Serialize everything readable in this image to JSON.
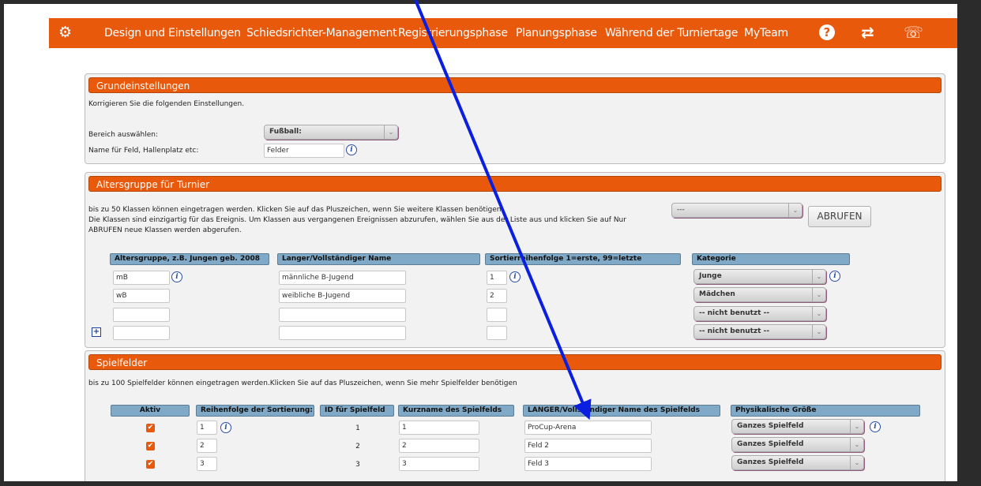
{
  "nav": {
    "items": [
      "Design und Einstellungen",
      "Schiedsrichter-Management",
      "Registrierungsphase",
      "Planungsphase",
      "Während der Turniertage",
      "MyTeam"
    ],
    "icons": [
      "gear-icon",
      "help-icon",
      "refresh-icon",
      "chat-icon"
    ]
  },
  "grund": {
    "title": "Grundeinstellungen",
    "desc": "Korrigieren Sie die folgenden Einstellungen.",
    "bereich_label": "Bereich auswählen:",
    "bereich_value": "Fußball:",
    "name_label": "Name für Feld, Hallenplatz etc:",
    "name_value": "Felder"
  },
  "alter": {
    "title": "Altersgruppe für Turnier",
    "desc1": "bis zu 50 Klassen können eingetragen werden. Klicken Sie auf das Pluszeichen, wenn Sie weitere Klassen benötigen",
    "desc2": "Die Klassen sind einzigartig für das Ereignis. Um Klassen aus vergangenen Ereignissen abzurufen, wählen Sie aus der Liste aus und klicken Sie auf Nur",
    "desc3": "ABRUFEN neue Klassen werden abgerufen.",
    "event_select": "---",
    "abrufen_label": "ABRUFEN",
    "headers": [
      "Altersgruppe, z.B. Jungen geb. 2008",
      "Langer/Vollständiger Name",
      "Sortierreihenfolge 1=erste, 99=letzte",
      "Kategorie"
    ],
    "rows": [
      {
        "kurz": "mB",
        "lang": "männliche B-Jugend",
        "sort": "1",
        "kategorie": "Junge"
      },
      {
        "kurz": "wB",
        "lang": "weibliche B-Jugend",
        "sort": "2",
        "kategorie": "Mädchen"
      },
      {
        "kurz": "",
        "lang": "",
        "sort": "",
        "kategorie": "-- nicht benutzt --"
      },
      {
        "kurz": "",
        "lang": "",
        "sort": "",
        "kategorie": "-- nicht benutzt --"
      }
    ]
  },
  "spiel": {
    "title": "Spielfelder",
    "desc": "bis zu 100 Spielfelder können eingetragen werden.Klicken Sie auf das Pluszeichen, wenn Sie mehr Spielfelder benötigen",
    "headers": [
      "Aktiv",
      "Reihenfolge der Sortierung:",
      "ID für Spielfeld",
      "Kurzname des Spielfelds",
      "LANGER/Vollständiger Name des Spielfelds",
      "Physikalische Größe"
    ],
    "rows": [
      {
        "aktiv": "✔",
        "sort": "1",
        "id": "1",
        "kurz": "1",
        "lang": "ProCup-Arena",
        "groesse": "Ganzes Spielfeld"
      },
      {
        "aktiv": "✔",
        "sort": "2",
        "id": "2",
        "kurz": "2",
        "lang": "Feld 2",
        "groesse": "Ganzes Spielfeld"
      },
      {
        "aktiv": "✔",
        "sort": "3",
        "id": "3",
        "kurz": "3",
        "lang": "Feld 3",
        "groesse": "Ganzes Spielfeld"
      }
    ]
  },
  "colors": {
    "accent": "#e8590c",
    "header_blue": "#7fa9c6",
    "arrow": "#0a1fe0"
  }
}
